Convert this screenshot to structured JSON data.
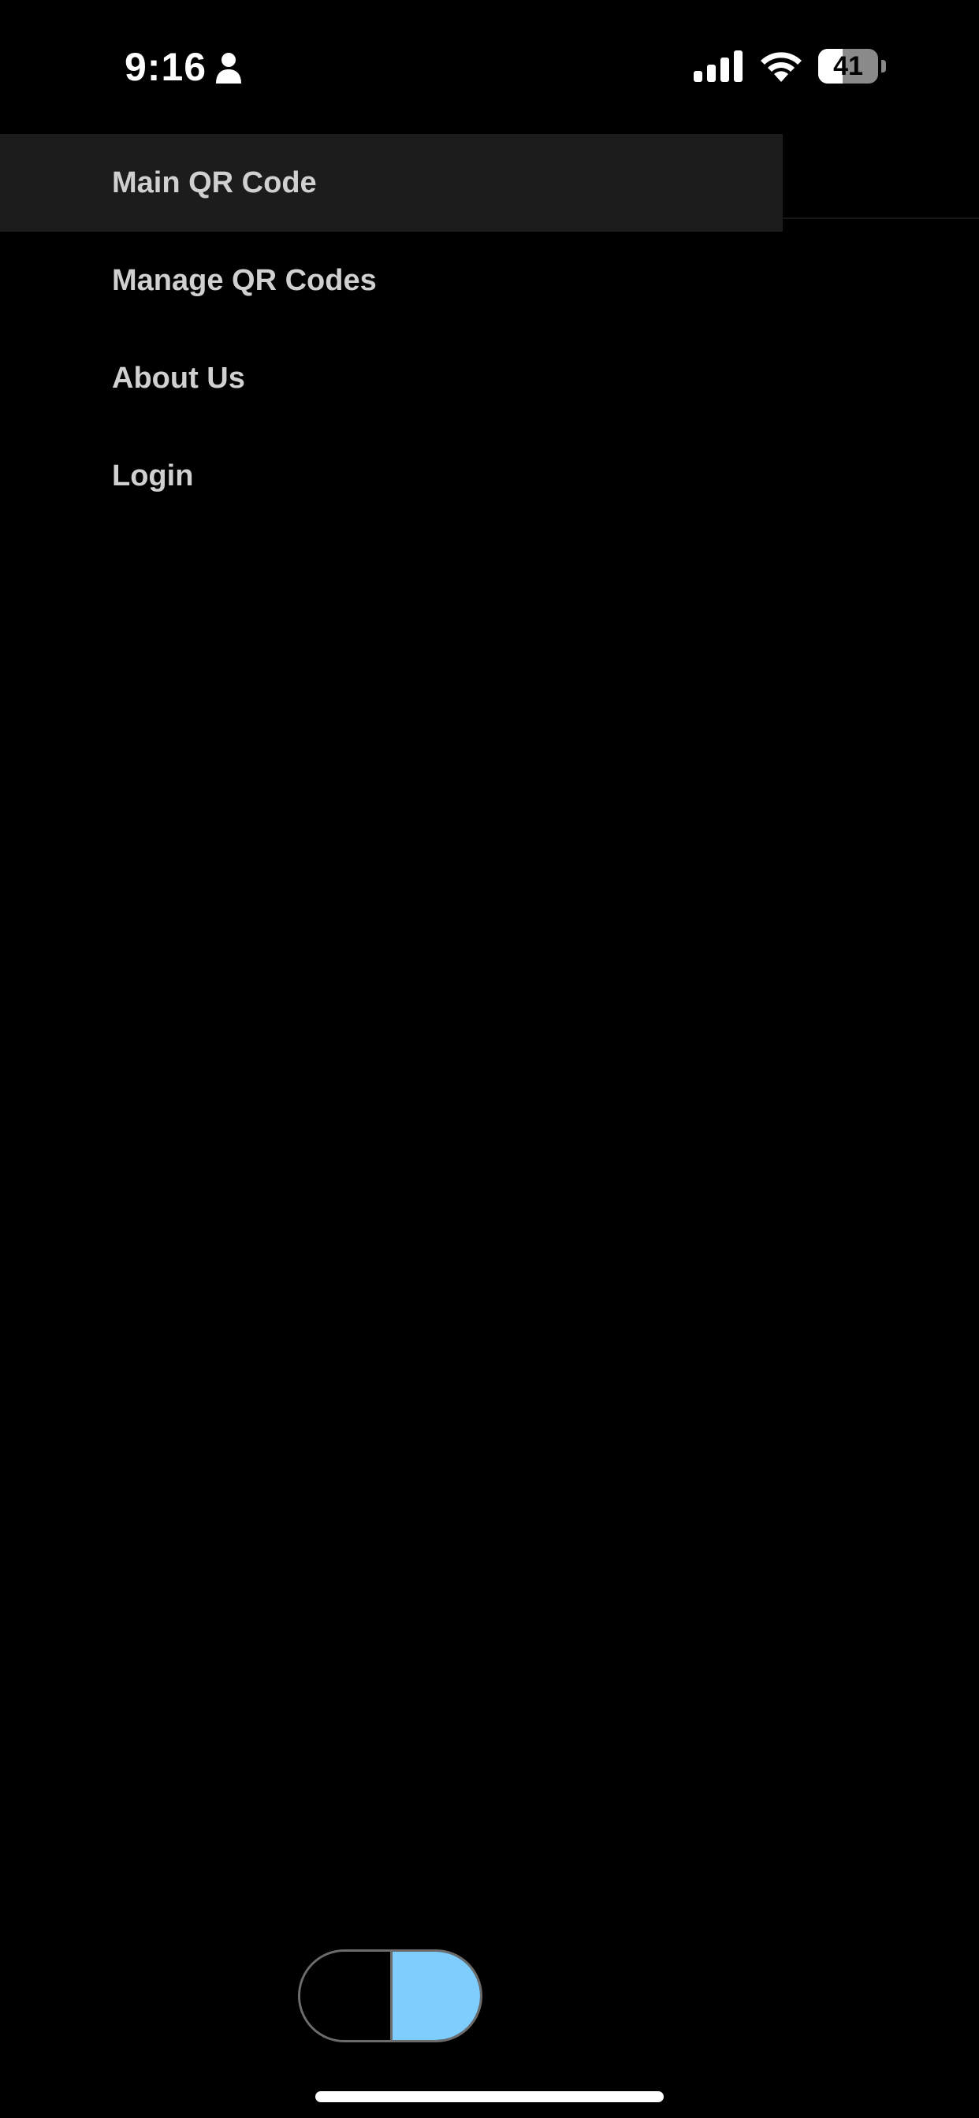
{
  "status_bar": {
    "time": "9:16",
    "battery_level": "41",
    "battery_fraction": 0.41
  },
  "drawer": {
    "items": [
      {
        "label": "Main QR Code",
        "active": true
      },
      {
        "label": "Manage QR Codes",
        "active": false
      },
      {
        "label": "About Us",
        "active": false
      },
      {
        "label": "Login",
        "active": false
      }
    ]
  },
  "theme_toggle": {
    "selected_side": "right",
    "selected_color": "#7fcdfd"
  },
  "colors": {
    "background": "#000000",
    "active_item_background": "#1c1c1c",
    "menu_text": "#d0d0d0",
    "accent": "#7fcdfd"
  },
  "icons": {
    "person": "person-icon",
    "signal": "cellular-signal-icon",
    "wifi": "wifi-icon",
    "battery": "battery-icon"
  }
}
